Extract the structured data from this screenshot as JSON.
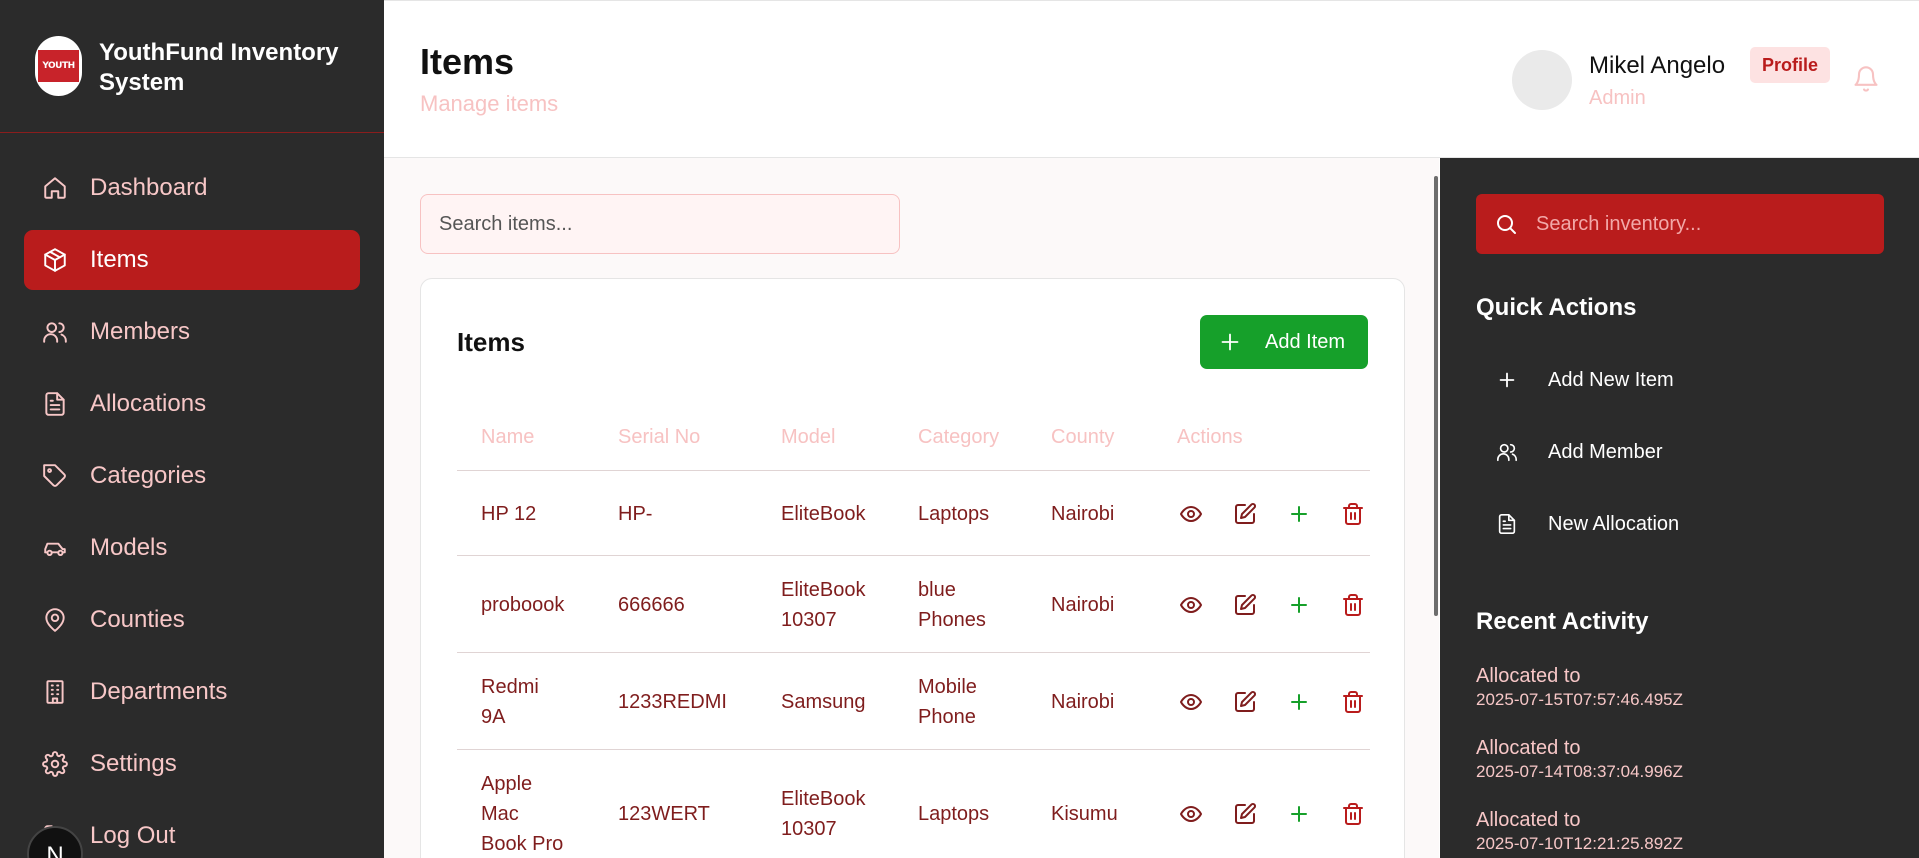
{
  "brand": {
    "title": "YouthFund Inventory System",
    "logo_text": "YOUTH"
  },
  "sidebar": {
    "items": [
      {
        "label": "Dashboard",
        "icon": "home-icon"
      },
      {
        "label": "Items",
        "icon": "package-icon",
        "active": true
      },
      {
        "label": "Members",
        "icon": "users-icon"
      },
      {
        "label": "Allocations",
        "icon": "file-text-icon"
      },
      {
        "label": "Categories",
        "icon": "tag-icon"
      },
      {
        "label": "Models",
        "icon": "car-icon"
      },
      {
        "label": "Counties",
        "icon": "map-pin-icon"
      },
      {
        "label": "Departments",
        "icon": "building-icon"
      },
      {
        "label": "Settings",
        "icon": "gear-icon"
      },
      {
        "label": "Log Out",
        "icon": "logout-icon"
      }
    ],
    "badge": "N"
  },
  "header": {
    "title": "Items",
    "subtitle": "Manage items",
    "user_name": "Mikel Angelo",
    "user_role": "Admin",
    "profile_label": "Profile"
  },
  "main": {
    "search_placeholder": "Search items...",
    "card_title": "Items",
    "add_button": "Add Item",
    "columns": [
      "Name",
      "Serial No",
      "Model",
      "Category",
      "County",
      "Actions"
    ],
    "rows": [
      {
        "name": [
          "HP 12"
        ],
        "serial": "HP-",
        "model": [
          "EliteBook"
        ],
        "category": [
          "Laptops"
        ],
        "county": "Nairobi"
      },
      {
        "name": [
          "proboook"
        ],
        "serial": "666666",
        "model": [
          "EliteBook",
          "10307"
        ],
        "category": [
          "blue",
          "Phones"
        ],
        "county": "Nairobi"
      },
      {
        "name": [
          "Redmi",
          "9A"
        ],
        "serial": "1233REDMI",
        "model": [
          "Samsung"
        ],
        "category": [
          "Mobile",
          "Phone"
        ],
        "county": "Nairobi"
      },
      {
        "name": [
          "Apple",
          "Mac",
          "Book Pro"
        ],
        "serial": "123WERT",
        "model": [
          "EliteBook",
          "10307"
        ],
        "category": [
          "Laptops"
        ],
        "county": "Kisumu"
      }
    ]
  },
  "right": {
    "search_placeholder": "Search inventory...",
    "quick_actions_title": "Quick Actions",
    "quick_actions": [
      "Add New Item",
      "Add Member",
      "New Allocation"
    ],
    "recent_title": "Recent Activity",
    "recent": [
      {
        "text": "Allocated to",
        "time": "2025-07-15T07:57:46.495Z"
      },
      {
        "text": "Allocated to",
        "time": "2025-07-14T08:37:04.996Z"
      },
      {
        "text": "Allocated to",
        "time": "2025-07-10T12:21:25.892Z"
      }
    ]
  },
  "colors": {
    "accent": "#b91c1c",
    "success": "#16a02a",
    "sidebar_bg": "#2b2b2b"
  }
}
